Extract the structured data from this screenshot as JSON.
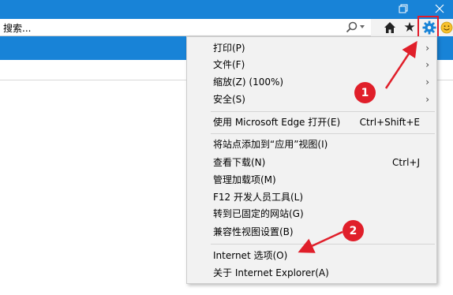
{
  "address": {
    "text": "搜索..."
  },
  "toolbar": {
    "home_icon": "home-icon",
    "favorites_icon": "star-icon",
    "tools_icon": "gear-icon",
    "feedback_icon": "smiley-icon"
  },
  "menu": {
    "items": [
      {
        "label": "打印(P)",
        "has_submenu": true
      },
      {
        "label": "文件(F)",
        "has_submenu": true
      },
      {
        "label": "缩放(Z) (100%)",
        "has_submenu": true
      },
      {
        "label": "安全(S)",
        "has_submenu": true
      },
      {
        "label": "使用 Microsoft Edge 打开(E)",
        "shortcut": "Ctrl+Shift+E"
      },
      {
        "label": "将站点添加到“应用”视图(I)"
      },
      {
        "label": "查看下载(N)",
        "shortcut": "Ctrl+J"
      },
      {
        "label": "管理加载项(M)"
      },
      {
        "label": "F12 开发人员工具(L)"
      },
      {
        "label": "转到已固定的网站(G)"
      },
      {
        "label": "兼容性视图设置(B)"
      },
      {
        "label": "Internet 选项(O)"
      },
      {
        "label": "关于 Internet Explorer(A)"
      }
    ]
  },
  "annotations": {
    "badge1": "1",
    "badge2": "2"
  },
  "colors": {
    "accent": "#1883d7",
    "annotation_red": "#e01f2a"
  }
}
